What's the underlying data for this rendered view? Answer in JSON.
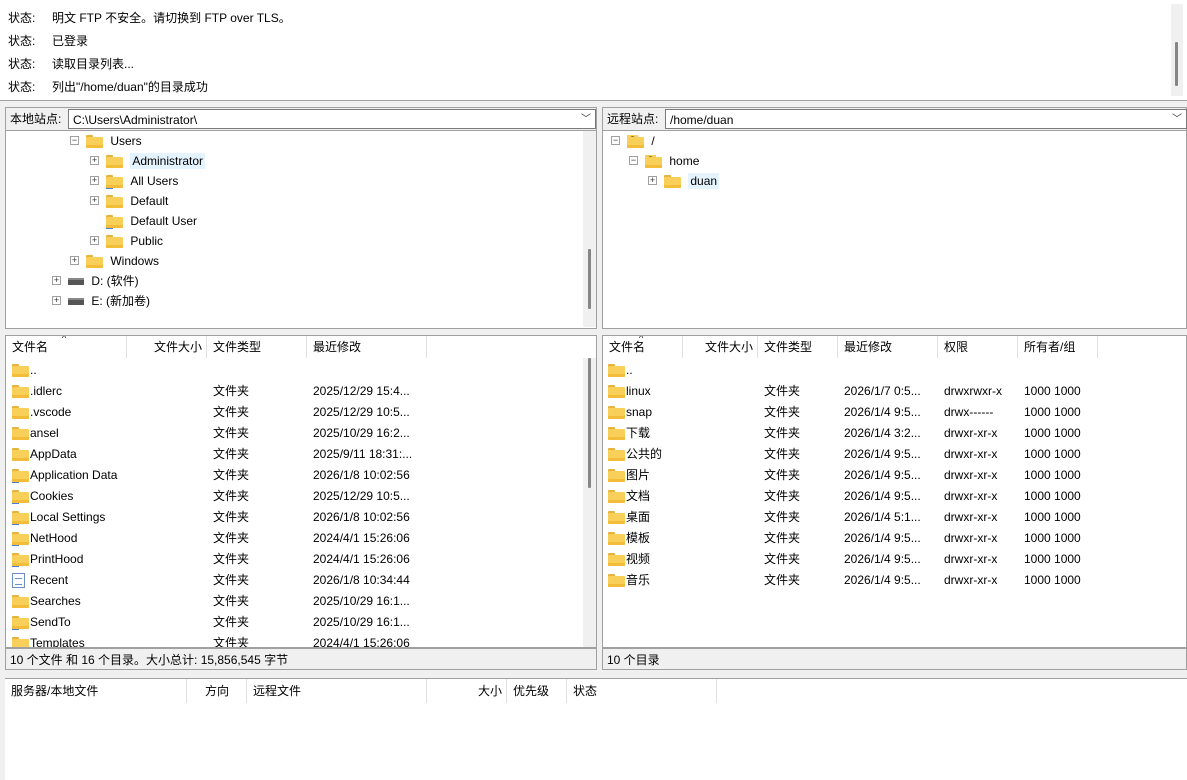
{
  "log": {
    "label": "状态:",
    "lines": [
      "明文 FTP 不安全。请切换到 FTP over TLS。",
      "已登录",
      "读取目录列表...",
      "列出\"/home/duan\"的目录成功"
    ]
  },
  "local_site": {
    "label": "本地站点:",
    "path": "C:\\Users\\Administrator\\",
    "tree": [
      "Users",
      "Administrator",
      "All Users",
      "Default",
      "Default User",
      "Public",
      "Windows",
      "D: (软件)",
      "E: (新加卷)"
    ]
  },
  "remote_site": {
    "label": "远程站点:",
    "path": "/home/duan",
    "tree": [
      "/",
      "home",
      "duan"
    ]
  },
  "local_columns": [
    "文件名",
    "文件大小",
    "文件类型",
    "最近修改"
  ],
  "local_files": [
    {
      "name": "..",
      "type": "",
      "modified": ""
    },
    {
      "name": ".idlerc",
      "type": "文件夹",
      "modified": "2025/12/29 15:4..."
    },
    {
      "name": ".vscode",
      "type": "文件夹",
      "modified": "2025/12/29 10:5..."
    },
    {
      "name": "ansel",
      "type": "文件夹",
      "modified": "2025/10/29 16:2..."
    },
    {
      "name": "AppData",
      "type": "文件夹",
      "modified": "2025/9/11 18:31:..."
    },
    {
      "name": "Application Data",
      "type": "文件夹",
      "modified": "2026/1/8 10:02:56"
    },
    {
      "name": "Cookies",
      "type": "文件夹",
      "modified": "2025/12/29 10:5..."
    },
    {
      "name": "Local Settings",
      "type": "文件夹",
      "modified": "2026/1/8 10:02:56"
    },
    {
      "name": "NetHood",
      "type": "文件夹",
      "modified": "2024/4/1 15:26:06"
    },
    {
      "name": "PrintHood",
      "type": "文件夹",
      "modified": "2024/4/1 15:26:06"
    },
    {
      "name": "Recent",
      "type": "文件夹",
      "modified": "2026/1/8 10:34:44"
    },
    {
      "name": "Searches",
      "type": "文件夹",
      "modified": "2025/10/29 16:1..."
    },
    {
      "name": "SendTo",
      "type": "文件夹",
      "modified": "2025/10/29 16:1..."
    },
    {
      "name": "Templates",
      "type": "文件夹",
      "modified": "2024/4/1 15:26:06"
    }
  ],
  "local_status": "10 个文件 和 16 个目录。大小总计: 15,856,545 字节",
  "remote_columns": [
    "文件名",
    "文件大小",
    "文件类型",
    "最近修改",
    "权限",
    "所有者/组"
  ],
  "remote_files": [
    {
      "name": "..",
      "type": "",
      "modified": "",
      "perm": "",
      "owner": ""
    },
    {
      "name": "linux",
      "type": "文件夹",
      "modified": "2026/1/7 0:5...",
      "perm": "drwxrwxr-x",
      "owner": "1000 1000"
    },
    {
      "name": "snap",
      "type": "文件夹",
      "modified": "2026/1/4 9:5...",
      "perm": "drwx------",
      "owner": "1000 1000"
    },
    {
      "name": "下载",
      "type": "文件夹",
      "modified": "2026/1/4 3:2...",
      "perm": "drwxr-xr-x",
      "owner": "1000 1000"
    },
    {
      "name": "公共的",
      "type": "文件夹",
      "modified": "2026/1/4 9:5...",
      "perm": "drwxr-xr-x",
      "owner": "1000 1000"
    },
    {
      "name": "图片",
      "type": "文件夹",
      "modified": "2026/1/4 9:5...",
      "perm": "drwxr-xr-x",
      "owner": "1000 1000"
    },
    {
      "name": "文档",
      "type": "文件夹",
      "modified": "2026/1/4 9:5...",
      "perm": "drwxr-xr-x",
      "owner": "1000 1000"
    },
    {
      "name": "桌面",
      "type": "文件夹",
      "modified": "2026/1/4 5:1...",
      "perm": "drwxr-xr-x",
      "owner": "1000 1000"
    },
    {
      "name": "模板",
      "type": "文件夹",
      "modified": "2026/1/4 9:5...",
      "perm": "drwxr-xr-x",
      "owner": "1000 1000"
    },
    {
      "name": "视频",
      "type": "文件夹",
      "modified": "2026/1/4 9:5...",
      "perm": "drwxr-xr-x",
      "owner": "1000 1000"
    },
    {
      "name": "音乐",
      "type": "文件夹",
      "modified": "2026/1/4 9:5...",
      "perm": "drwxr-xr-x",
      "owner": "1000 1000"
    }
  ],
  "remote_status": "10 个目录",
  "queue_columns": [
    "服务器/本地文件",
    "方向",
    "远程文件",
    "大小",
    "优先级",
    "状态"
  ]
}
